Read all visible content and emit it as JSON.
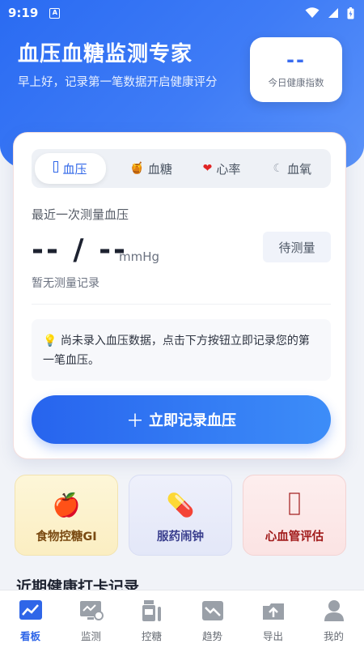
{
  "status_bar": {
    "time": "9:19",
    "notif_badge": "A"
  },
  "header": {
    "title": "血压血糖监测专家",
    "subtitle": "早上好，记录第一笔数据开启健康评分",
    "score_value": "--",
    "score_label": "今日健康指数"
  },
  "tabs": [
    {
      "label": "血压",
      "icon": "bp-icon"
    },
    {
      "label": "血糖",
      "icon": "honey-icon"
    },
    {
      "label": "心率",
      "icon": "heart-icon"
    },
    {
      "label": "血氧",
      "icon": "spo2-icon"
    }
  ],
  "reading": {
    "label": "最近一次测量血压",
    "value": "-- / --",
    "unit": "mmHg",
    "status": "待测量",
    "note": "暂无测量记录"
  },
  "tip": {
    "icon": "bulb-icon",
    "text": "尚未录入血压数据，点击下方按钮立即记录您的第一笔血压。"
  },
  "record_button": {
    "label": "立即记录血压",
    "icon": "plus-icon"
  },
  "quick_actions": [
    {
      "label": "食物控糖GI",
      "icon": "apple-icon"
    },
    {
      "label": "服药闹钟",
      "icon": "pill-icon"
    },
    {
      "label": "心血管评估",
      "icon": "heart-rate-icon"
    }
  ],
  "section_title": "近期健康打卡记录",
  "bottom_nav": [
    {
      "label": "看板",
      "icon": "dashboard-icon",
      "active": true
    },
    {
      "label": "监测",
      "icon": "monitor-icon",
      "active": false
    },
    {
      "label": "控糖",
      "icon": "bottle-icon",
      "active": false
    },
    {
      "label": "趋势",
      "icon": "trend-icon",
      "active": false
    },
    {
      "label": "导出",
      "icon": "export-icon",
      "active": false
    },
    {
      "label": "我的",
      "icon": "user-icon",
      "active": false
    }
  ],
  "colors": {
    "primary": "#2f66e8",
    "hero_start": "#2a6bf2",
    "hero_end": "#5b93f9"
  }
}
